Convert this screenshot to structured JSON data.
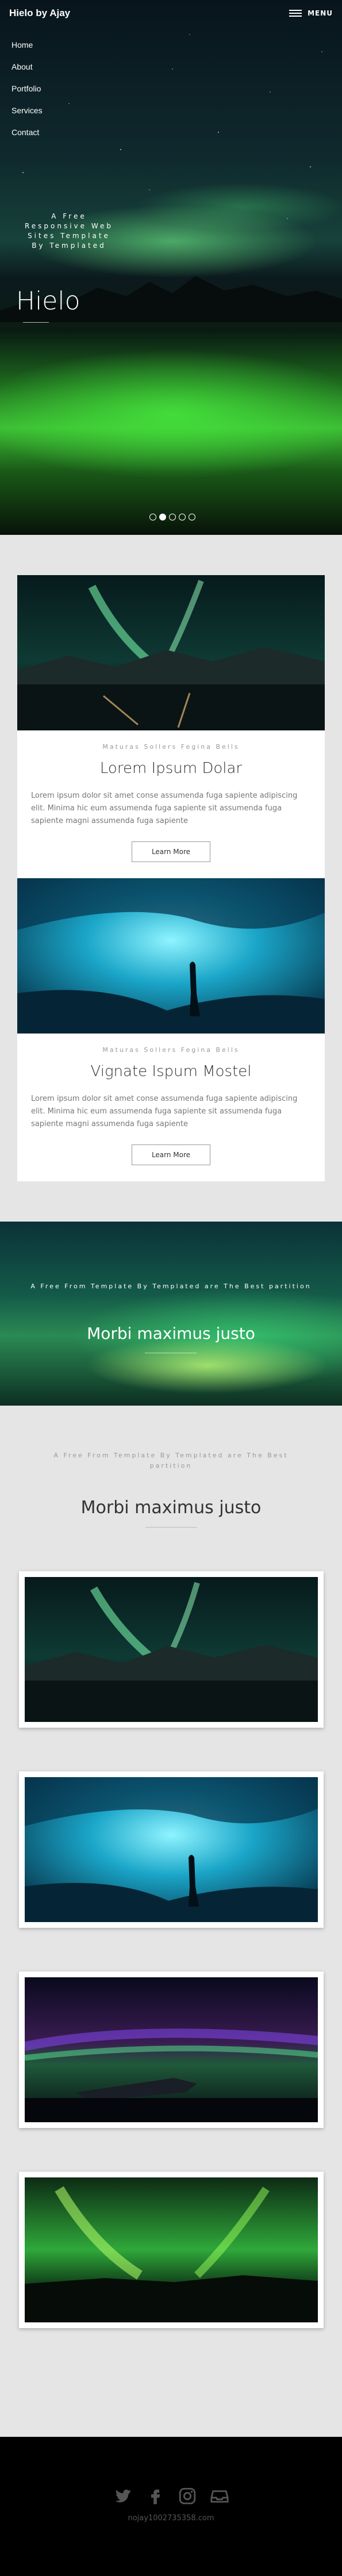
{
  "header": {
    "brand": "Hielo by Ajay",
    "menu_label": "MENU"
  },
  "nav": [
    "Home",
    "About",
    "Portfolio",
    "Services",
    "Contact"
  ],
  "hero": {
    "subtitle": "A Free Responsive Web Sites Template By Templated",
    "title": "Hielo",
    "slides": 5,
    "active_slide": 2
  },
  "cards": [
    {
      "eyebrow": "Maturas Sollers Fegina Bells",
      "title": "Lorem Ipsum Dolar",
      "text": "Lorem ipsum dolor sit amet conse assumenda fuga sapiente adipiscing elit. Minima hic eum assumenda fuga sapiente sit assumenda fuga sapiente magni assumenda fuga sapiente",
      "button": "Learn More",
      "image": "aurora-lake"
    },
    {
      "eyebrow": "Maturas Sollers Fegina Bells",
      "title": "Vignate Ispum Mostel",
      "text": "Lorem ipsum dolor sit amet conse assumenda fuga sapiente adipiscing elit. Minima hic eum assumenda fuga sapiente sit assumenda fuga sapiente magni assumenda fuga sapiente",
      "button": "Learn More",
      "image": "ice-cave"
    }
  ],
  "banner": {
    "eyebrow": "A Free From Template By Templated are The Best partition",
    "title": "Morbi maximus justo"
  },
  "gallery": {
    "eyebrow": "A Free From Template By Templated are The Best partition",
    "title": "Morbi maximus justo",
    "images": [
      "aurora-lake",
      "ice-cave",
      "aurora-plane-wreck",
      "aurora-village"
    ]
  },
  "footer": {
    "icons": [
      "twitter-icon",
      "facebook-icon",
      "instagram-icon",
      "inbox-icon"
    ],
    "email": "nojay1002735358.com"
  }
}
